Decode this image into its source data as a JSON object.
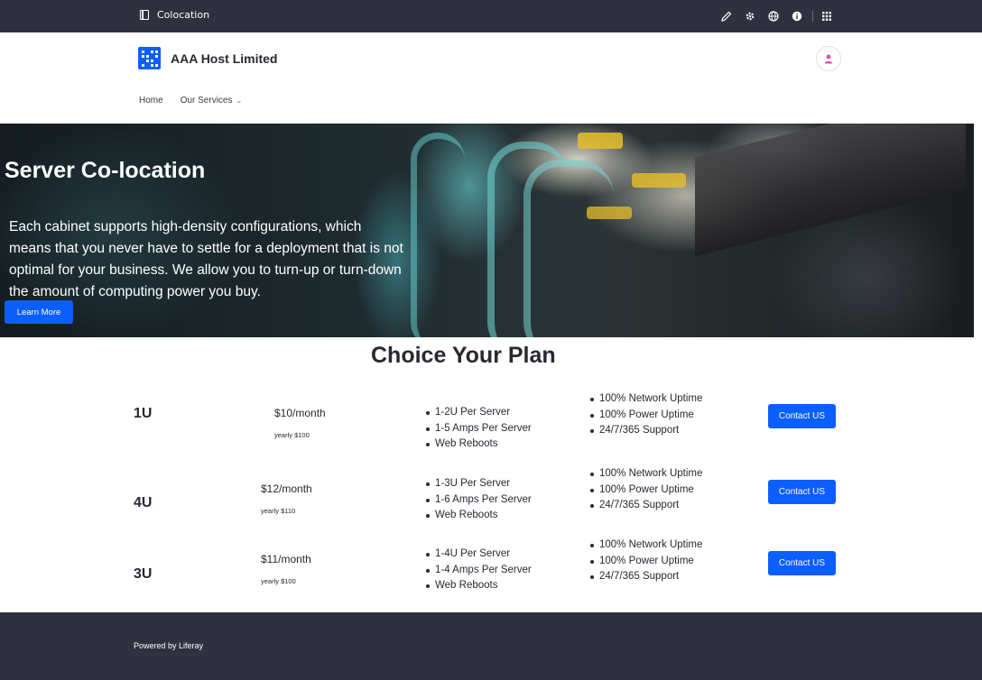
{
  "control_bar": {
    "title": "Colocation",
    "tools": [
      {
        "icon": "pencil-icon",
        "name": "edit-button"
      },
      {
        "icon": "gear-icon",
        "name": "settings-button"
      },
      {
        "icon": "globe-icon",
        "name": "language-button"
      },
      {
        "icon": "info-icon",
        "name": "info-button"
      },
      {
        "icon": "apps-grid-icon",
        "name": "applications-menu-button"
      }
    ]
  },
  "header": {
    "site_name": "AAA Host Limited",
    "nav": [
      {
        "label": "Home"
      },
      {
        "label": "Our Services"
      }
    ]
  },
  "hero": {
    "title": "Server Co-location",
    "text": "Each cabinet supports high-density configurations, which means that you never have to settle for a deployment that is not optimal for your business. We allow you to turn-up or turn-down the amount of computing power you buy.",
    "button_label": "Learn More"
  },
  "plans": {
    "title": "Choice Your Plan",
    "items": [
      {
        "name": "1U",
        "price": "$10/month",
        "yearly": "yearly $100",
        "features": [
          "1-2U Per Server",
          "1-5 Amps Per Server",
          "Web Reboots"
        ],
        "guarantees": [
          "100% Network Uptime",
          "100% Power Uptime",
          "24/7/365 Support"
        ],
        "button_label": "Contact US"
      },
      {
        "name": "4U",
        "price": "$12/month",
        "yearly": "yearly $110",
        "features": [
          "1-3U Per Server",
          "1-6 Amps Per Server",
          "Web Reboots"
        ],
        "guarantees": [
          "100% Network Uptime",
          "100% Power Uptime",
          "24/7/365 Support"
        ],
        "button_label": "Contact US"
      },
      {
        "name": "3U",
        "price": "$11/month",
        "yearly": "yearly $100",
        "features": [
          "1-4U Per Server",
          "1-4 Amps Per Server",
          "Web Reboots"
        ],
        "guarantees": [
          "100% Network Uptime",
          "100% Power Uptime",
          "24/7/365 Support"
        ],
        "button_label": "Contact US"
      }
    ]
  },
  "footer": {
    "text": "Powered by Liferay"
  },
  "colors": {
    "control_bar": "#30313f",
    "accent": "#0b5fff",
    "avatar_icon": "#e94d9e"
  }
}
